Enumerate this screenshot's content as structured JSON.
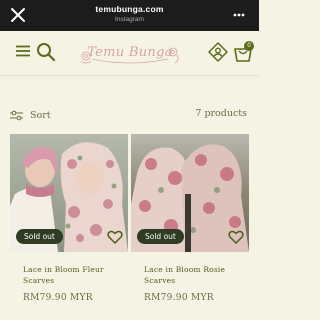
{
  "browser": {
    "url": "temubunga.com",
    "subtitle": "Instagram",
    "close_icon": "close-icon",
    "more_icon": "more-icon"
  },
  "header": {
    "logo_text": "Temu Bunga",
    "cart_count": "0"
  },
  "toolbar": {
    "sort_label": "Sort",
    "product_count": "7 products"
  },
  "products": [
    {
      "title": "Lace in Bloom Fleur Scarves",
      "price": "RM79.90 MYR",
      "badge": "Sold out"
    },
    {
      "title": "Lace in Bloom Rosie Scarves",
      "price": "RM79.90 MYR",
      "badge": "Sold out"
    }
  ],
  "colors": {
    "background": "#f5f3e4",
    "accent": "#5a6b1c",
    "badge": "#2f3c23",
    "logo": "#d7a3a6"
  }
}
